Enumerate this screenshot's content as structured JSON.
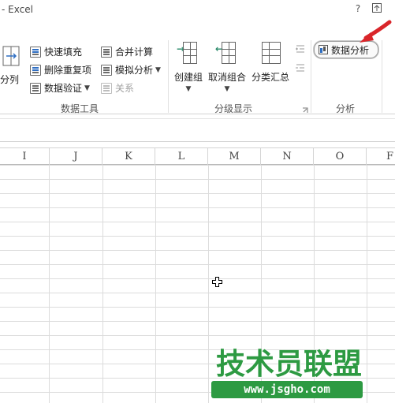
{
  "window": {
    "title": "- Excel",
    "help_label": "?",
    "restore_icon": "restore-ribbon-icon"
  },
  "ribbon": {
    "left_partial_label": "分列",
    "data_tools": {
      "label": "数据工具",
      "flash_fill": "快速填充",
      "remove_duplicates": "删除重复项",
      "data_validation": "数据验证",
      "consolidate": "合并计算",
      "what_if": "模拟分析",
      "relationships": "关系"
    },
    "outline": {
      "label": "分级显示",
      "group": "创建组",
      "ungroup": "取消组合",
      "subtotal": "分类汇总"
    },
    "analysis": {
      "label": "分析",
      "data_analysis": "数据分析"
    }
  },
  "sheet": {
    "columns": [
      "I",
      "J",
      "K",
      "L",
      "M",
      "N",
      "O",
      "F"
    ]
  },
  "watermark": {
    "title": "技术员联盟",
    "url": "www.jsgho.com"
  },
  "colors": {
    "accent_red": "#d9252a",
    "watermark_green": "#2d9a42",
    "icon_blue": "#2f6ec2"
  }
}
